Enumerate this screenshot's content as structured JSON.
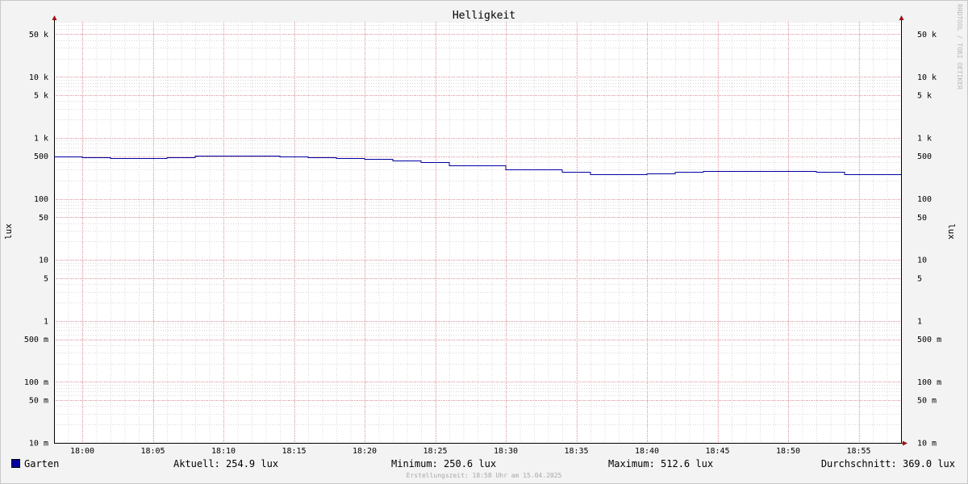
{
  "chart_data": {
    "type": "line",
    "title": "Helligkeit",
    "ylabel": "lux",
    "y_scale": "log",
    "ylim": [
      0.01,
      80000
    ],
    "xlim": [
      "17:58",
      "18:58"
    ],
    "x_ticks": [
      "18:00",
      "18:05",
      "18:10",
      "18:15",
      "18:20",
      "18:25",
      "18:30",
      "18:35",
      "18:40",
      "18:45",
      "18:50",
      "18:55"
    ],
    "y_ticks": [
      {
        "value": 50000,
        "label": "50 k"
      },
      {
        "value": 10000,
        "label": "10 k"
      },
      {
        "value": 5000,
        "label": "5 k"
      },
      {
        "value": 1000,
        "label": "1 k"
      },
      {
        "value": 500,
        "label": "500"
      },
      {
        "value": 100,
        "label": "100"
      },
      {
        "value": 50,
        "label": "50"
      },
      {
        "value": 10,
        "label": "10"
      },
      {
        "value": 5,
        "label": "5"
      },
      {
        "value": 1,
        "label": "1"
      },
      {
        "value": 0.5,
        "label": "500 m"
      },
      {
        "value": 0.1,
        "label": "100 m"
      },
      {
        "value": 0.05,
        "label": "50 m"
      },
      {
        "value": 0.01,
        "label": "10 m"
      }
    ],
    "grid": true,
    "series": [
      {
        "name": "Garten",
        "color": "#0000a0",
        "step": true,
        "x": [
          "17:58",
          "18:00",
          "18:02",
          "18:04",
          "18:06",
          "18:08",
          "18:10",
          "18:12",
          "18:14",
          "18:16",
          "18:18",
          "18:20",
          "18:22",
          "18:24",
          "18:26",
          "18:28",
          "18:30",
          "18:32",
          "18:34",
          "18:36",
          "18:38",
          "18:40",
          "18:42",
          "18:44",
          "18:46",
          "18:48",
          "18:50",
          "18:52",
          "18:54",
          "18:56"
        ],
        "values": [
          495,
          485,
          470,
          470,
          480,
          512.6,
          512,
          512,
          495,
          480,
          460,
          455,
          425,
          395,
          355,
          355,
          305,
          305,
          275,
          250.6,
          250.6,
          265,
          280,
          290,
          290,
          290,
          290,
          280,
          254.9,
          254.9
        ]
      }
    ]
  },
  "legend": {
    "series_name": "Garten",
    "swatch_color": "#0000a0",
    "current": "Aktuell: 254.9 lux",
    "minimum": "Minimum: 250.6 lux",
    "maximum": "Maximum: 512.6 lux",
    "average": "Durchschnitt: 369.0 lux"
  },
  "footer": "Erstellungszeit: 18:58 Uhr am 15.04.2025",
  "watermark": "RRDTOOL / TOBI OETIKER",
  "colors": {
    "background": "#f3f3f3",
    "plot_background": "#ffffff",
    "minor_grid": "#d8d8d8",
    "major_grid": "#e8a0a8",
    "axis": "#000000",
    "arrow": "#a01010"
  }
}
